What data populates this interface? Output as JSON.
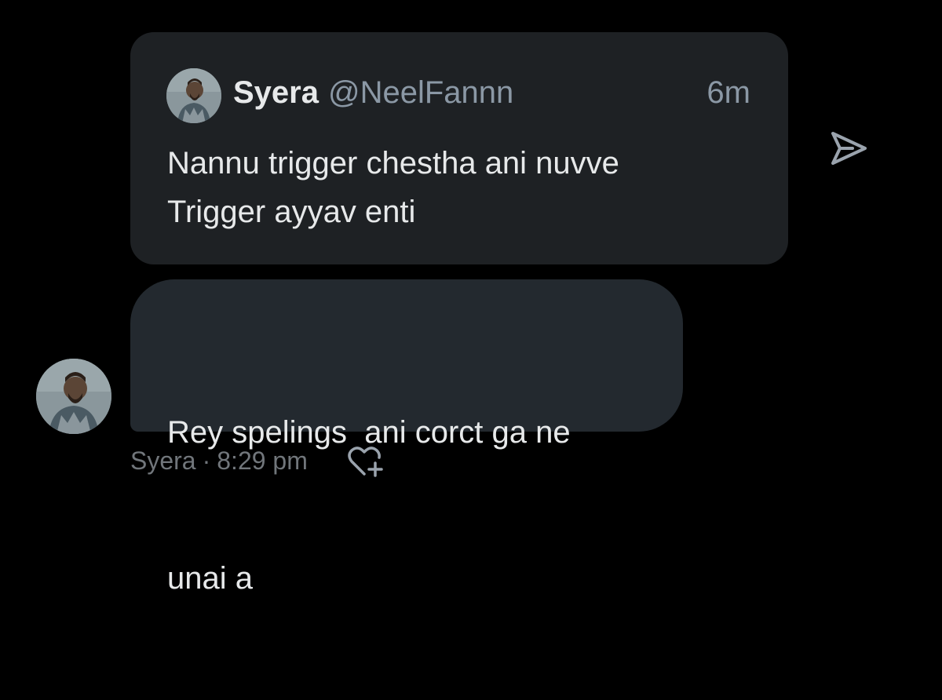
{
  "quote": {
    "name": "Syera",
    "handle": "@NeelFannn",
    "time": "6m",
    "text_line1": "Nannu trigger chestha ani nuvve",
    "text_line2": "Trigger ayyav enti",
    "avatar_icon": "user-avatar"
  },
  "message": {
    "text_line1": "Rey spelings  ani corct ga ne",
    "text_line2": "unai a"
  },
  "meta": {
    "sender": "Syera",
    "separator": "·",
    "time": "8:29 pm"
  },
  "icons": {
    "share": "send-icon",
    "react": "heart-plus-icon"
  },
  "colors": {
    "background": "#000000",
    "quote_card": "#1e2124",
    "message_bubble": "#23292f",
    "primary_text": "#e7e9ea",
    "secondary_text": "#8b98a5",
    "meta_text": "#71767b"
  }
}
